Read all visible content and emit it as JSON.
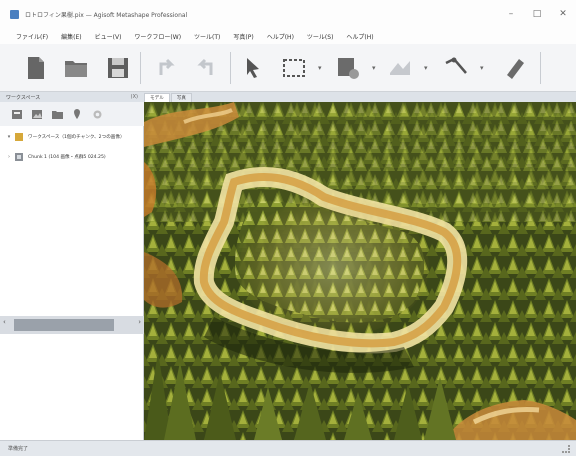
{
  "window": {
    "title": "ロトロフィン果樹.pix — Agisoft Metashape Professional",
    "minimize_glyph": "–",
    "maximize_glyph": "□",
    "close_glyph": "✕"
  },
  "menu": {
    "items": [
      "ファイル(F)",
      "編集(E)",
      "ビュー(V)",
      "ワークフロー(W)",
      "ツール(T)",
      "写真(P)",
      "ヘルプ(H)",
      "ツール(S)",
      "ヘルプ(H)"
    ]
  },
  "toolbar": {
    "icons": [
      "new-document-icon",
      "open-folder-icon",
      "save-disk-icon",
      "undo-icon",
      "redo-icon",
      "cursor-arrow-icon",
      "rectangle-select-icon",
      "shape-icon",
      "model-view-icon",
      "ruler-icon",
      "eraser-icon"
    ]
  },
  "workspace_panel": {
    "title": "ワークスペース",
    "close_label": "(X)",
    "tree": [
      {
        "label": "ワークスペース（1個のチャンク、2つの画像）"
      },
      {
        "label": "Chunk 1 (104 画像・点群5 024.25)"
      }
    ]
  },
  "tabs": [
    {
      "label": "モデル"
    },
    {
      "label": "写真"
    }
  ],
  "status": {
    "text": "準備完了"
  },
  "colors": {
    "forest_dark": "#2f3a14",
    "canopy": "#7d8f2c",
    "highlight": "#f2e3a3",
    "orange_canopy": "#c98a3a"
  }
}
